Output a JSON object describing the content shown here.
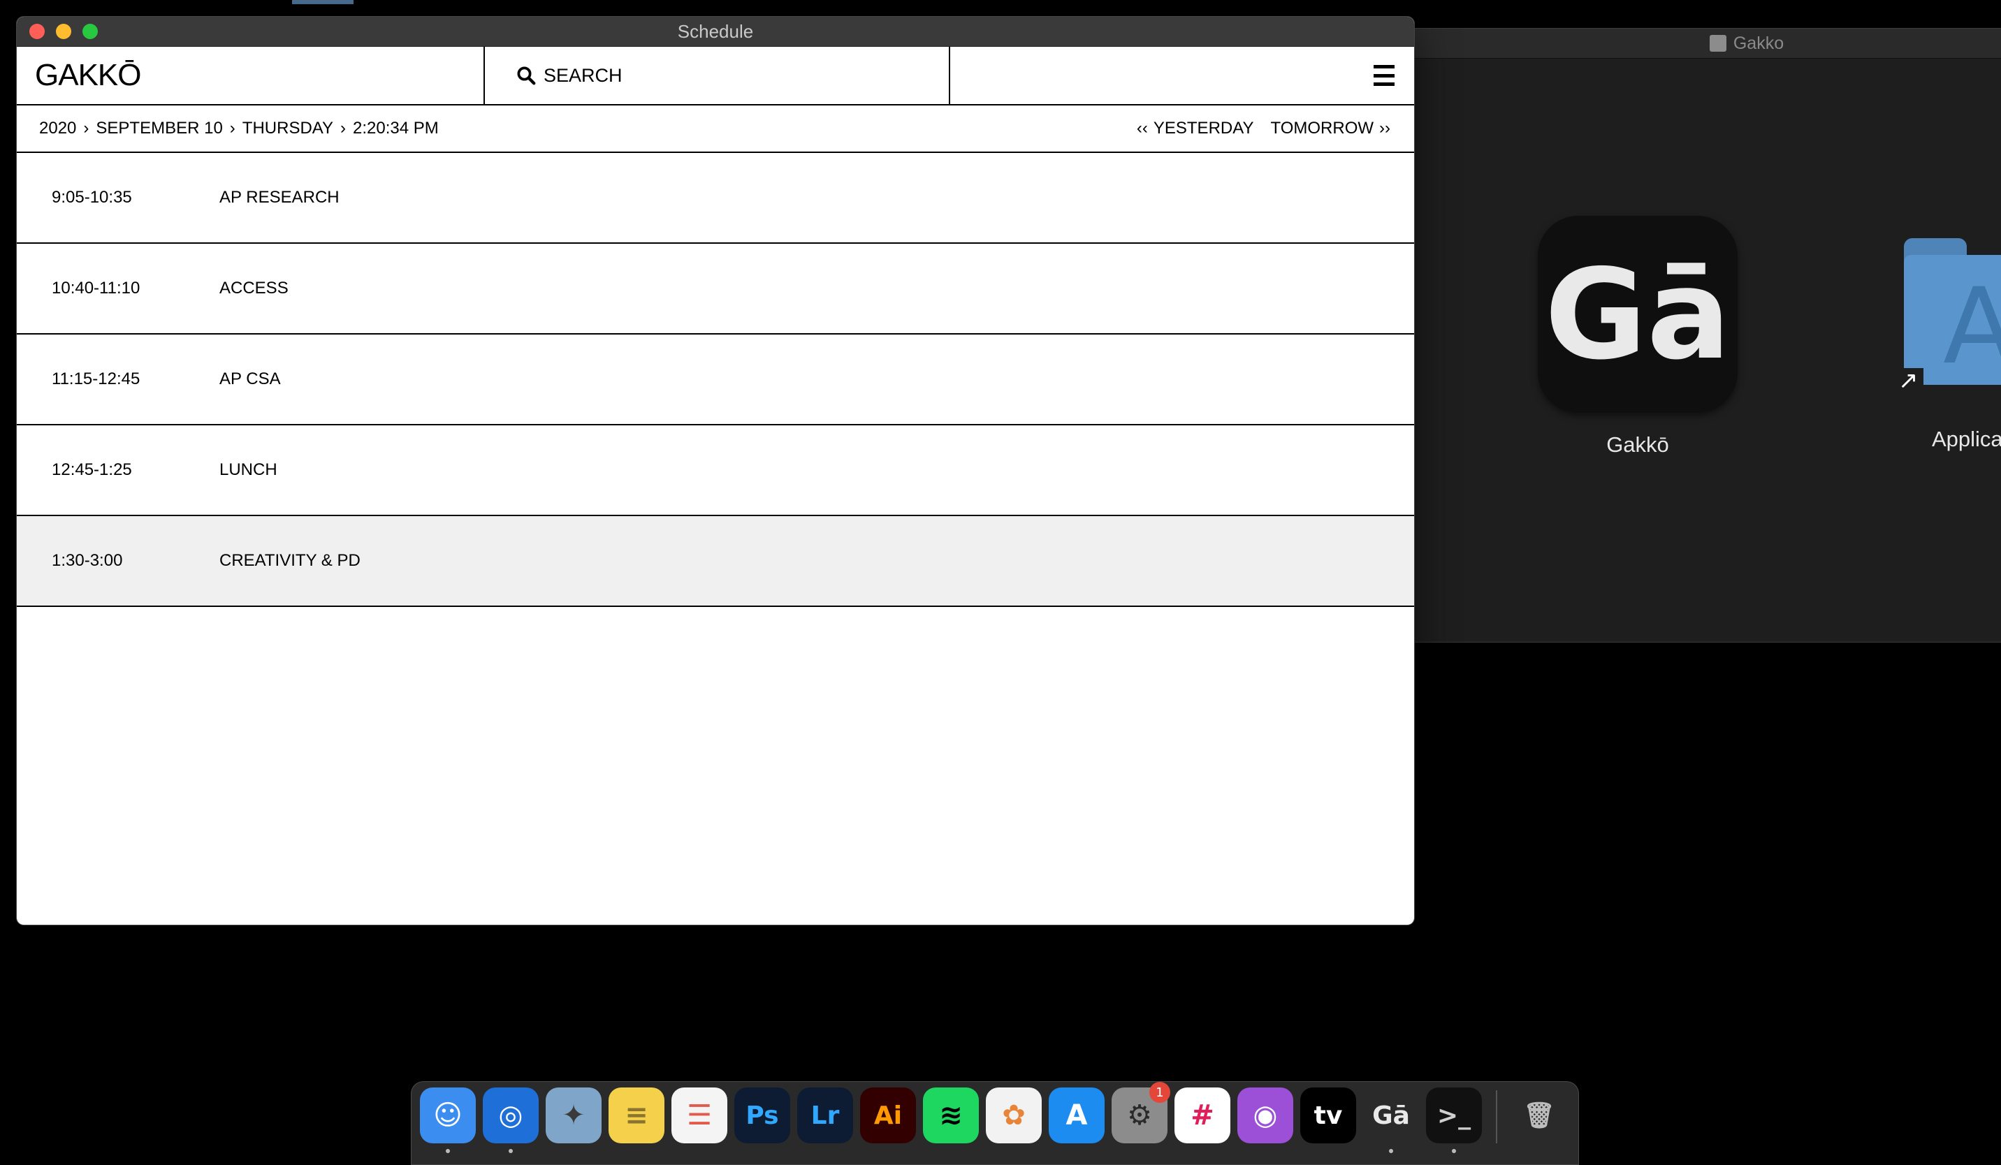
{
  "window": {
    "title": "Schedule"
  },
  "header": {
    "logo": "GAKKŌ",
    "search_label": "SEARCH"
  },
  "breadcrumb": {
    "year": "2020",
    "date": "SEPTEMBER 10",
    "weekday": "THURSDAY",
    "time": "2:20:34 PM"
  },
  "day_nav": {
    "prev_label": "YESTERDAY",
    "next_label": "TOMORROW"
  },
  "schedule": [
    {
      "time": "9:05-10:35",
      "period": "AP RESEARCH",
      "active": false
    },
    {
      "time": "10:40-11:10",
      "period": "ACCESS",
      "active": false
    },
    {
      "time": "11:15-12:45",
      "period": "AP CSA",
      "active": false
    },
    {
      "time": "12:45-1:25",
      "period": "LUNCH",
      "active": false
    },
    {
      "time": "1:30-3:00",
      "period": "CREATIVITY & PD",
      "active": true
    }
  ],
  "finder": {
    "title": "Gakko",
    "items": [
      {
        "label": "Gakkō",
        "icon": "gakko-app-icon",
        "glyph": "Gā"
      },
      {
        "label": "Applica",
        "icon": "applications-folder-icon"
      }
    ]
  },
  "dock": {
    "items": [
      {
        "name": "finder",
        "glyph": "☺",
        "bg": "#3b8ef0",
        "fg": "#ffffff"
      },
      {
        "name": "safari",
        "glyph": "◎",
        "bg": "#1e6fd8",
        "fg": "#ffffff"
      },
      {
        "name": "preview",
        "glyph": "✦",
        "bg": "#7fa6c8",
        "fg": "#3a3a3a"
      },
      {
        "name": "notes",
        "glyph": "≡",
        "bg": "#f5d04a",
        "fg": "#8a7530"
      },
      {
        "name": "reminders",
        "glyph": "☰",
        "bg": "#f4f4f4",
        "fg": "#e15b4d"
      },
      {
        "name": "photoshop",
        "glyph": "Ps",
        "bg": "#0e1c33",
        "fg": "#31a8ff"
      },
      {
        "name": "lightroom",
        "glyph": "Lr",
        "bg": "#0e1c33",
        "fg": "#31a8ff"
      },
      {
        "name": "illustrator",
        "glyph": "Ai",
        "bg": "#330000",
        "fg": "#ff9a00"
      },
      {
        "name": "spotify",
        "glyph": "≋",
        "bg": "#1ed760",
        "fg": "#000000"
      },
      {
        "name": "photos",
        "glyph": "✿",
        "bg": "#f2f2f2",
        "fg": "#e8833a"
      },
      {
        "name": "app-store",
        "glyph": "A",
        "bg": "#1c8cf0",
        "fg": "#ffffff"
      },
      {
        "name": "system-preferences",
        "glyph": "⚙",
        "bg": "#8c8c8c",
        "fg": "#2a2a2a",
        "badge": "1"
      },
      {
        "name": "slack",
        "glyph": "#",
        "bg": "#ffffff",
        "fg": "#e01e5a"
      },
      {
        "name": "podcasts",
        "glyph": "◉",
        "bg": "#9c4fd7",
        "fg": "#ffffff"
      },
      {
        "name": "apple-tv",
        "glyph": "tv",
        "bg": "#000000",
        "fg": "#ffffff"
      },
      {
        "name": "gakko",
        "glyph": "Gā",
        "bg": "#2a2a2a",
        "fg": "#e9e9e9"
      },
      {
        "name": "terminal",
        "glyph": ">_",
        "bg": "#111111",
        "fg": "#d0d0d0"
      },
      {
        "name": "trash",
        "glyph": "🗑",
        "bg": "#2a2a2a",
        "fg": "#bdbdbd"
      }
    ]
  }
}
